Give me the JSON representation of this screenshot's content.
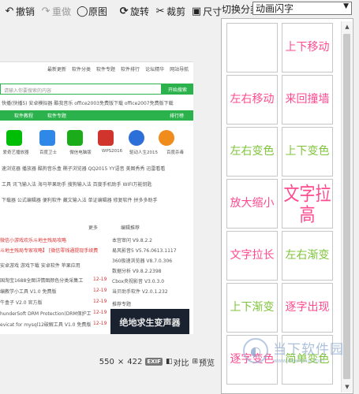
{
  "toolbar": {
    "undo": "撤销",
    "redo": "重做",
    "original": "原图",
    "rotate": "旋转",
    "crop": "裁剪",
    "size": "尺寸"
  },
  "right_panel": {
    "category_label": "切换分类",
    "category_value": "动画闪字",
    "effects": [
      {
        "label": "",
        "color": "#ffffff"
      },
      {
        "label": "上下移动",
        "color": "#ff4a8d"
      },
      {
        "label": "左右移动",
        "color": "#ff4a8d"
      },
      {
        "label": "来回撞墙",
        "color": "#ff4a8d"
      },
      {
        "label": "左右变色",
        "color": "#7ec43a"
      },
      {
        "label": "上下变色",
        "color": "#7ec43a"
      },
      {
        "label": "放大缩小",
        "color": "#ff4a8d"
      },
      {
        "label": "文字拉高",
        "color": "#ff4a8d"
      },
      {
        "label": "文字拉长",
        "color": "#ff4a8d"
      },
      {
        "label": "左右渐变",
        "color": "#7ec43a"
      },
      {
        "label": "上下渐变",
        "color": "#7ec43a"
      },
      {
        "label": "逐字出现",
        "color": "#ff4a8d"
      },
      {
        "label": "逐字变色",
        "color": "#ff4a8d"
      },
      {
        "label": "简单变色",
        "color": "#7ec43a"
      }
    ]
  },
  "status": {
    "width": "550",
    "times": "×",
    "height": "422",
    "exif": "EXIF",
    "compare": "对比",
    "preview": "预览"
  },
  "watermark": {
    "title": "当下软件园",
    "url": "www.downxia.com"
  },
  "webpage": {
    "top_links": [
      "最新更新",
      "软件分类",
      "软件专题",
      "软件排行",
      "论坛精华",
      "网站导航"
    ],
    "search_placeholder": "请输入你要搜索的内容",
    "search_button": "开始搜索",
    "hot_words": "快播(快播5)  安卓模拟器  酷我音乐  office2003免费版下载  office2007免费版下载",
    "nav_tabs": [
      "软件教程",
      "软件专题"
    ],
    "rank_label": "排行榜",
    "apps": [
      {
        "name": "爱奇艺播放器",
        "color": "#00be06"
      },
      {
        "name": "百度卫士",
        "color": "#2f87e8"
      },
      {
        "name": "微信电脑版",
        "color": "#1aad19"
      },
      {
        "name": "WPS2016",
        "color": "#d0342c"
      },
      {
        "name": "驱动人生2015",
        "color": "#2d6fd8"
      },
      {
        "name": "百度杀毒",
        "color": "#f08c1c"
      }
    ],
    "link_rows": [
      "速浏览器  播放器  酷狗音乐盒  椭子浏览器  QQ2015  YY语音  美图秀秀  迅雷看看",
      "工具  讯飞输入法  海马苹果助手  搜狗输入法  百度手机助手  WIFI万能钥匙",
      "下载器  公式编辑器  便利软件  藏文输入法  单证编辑器  修复软件  拼多多助手"
    ],
    "list_header": "更多",
    "editor_label": "编辑推荐",
    "articles": [
      {
        "title": "微信小游戏欢乐斗地主残局攻略",
        "date": ""
      },
      {
        "title": "斗地主残局专家攻略】 [微信零钱通提现手续费",
        "date": ""
      },
      {
        "title": "安卓游戏  游戏下载  安卓软件  苹果应用",
        "date": ""
      },
      {
        "title": "国淘宝1688全图详情图颜色分类采集工",
        "date": "12-19"
      },
      {
        "title": "编教学小工具 V1.0 免费版",
        "date": "12-19"
      },
      {
        "title": "牛盒子 V2.0 官方版",
        "date": "12-19"
      },
      {
        "title": "hunderSoft DRM Protection(DRM保护工",
        "date": "12-19"
      },
      {
        "title": "evicat for mysql12破解工具 V1.0 免费版",
        "date": "12-19"
      }
    ],
    "recommend": [
      {
        "name": "本宫审问  V9.8.2.2"
      },
      {
        "name": "易风影音5  V5.76.0613.1117"
      },
      {
        "name": "360极速浏览器  V8.7.0.306"
      },
      {
        "name": "数据分析  V9.8.2.2398"
      },
      {
        "name": "Cbox央视影音  V3.0.3.0"
      },
      {
        "name": "当贝助手软件  V2.0.1.232"
      }
    ],
    "recommend_label": "推荐专题",
    "banner_text": "绝地求生变声器"
  }
}
